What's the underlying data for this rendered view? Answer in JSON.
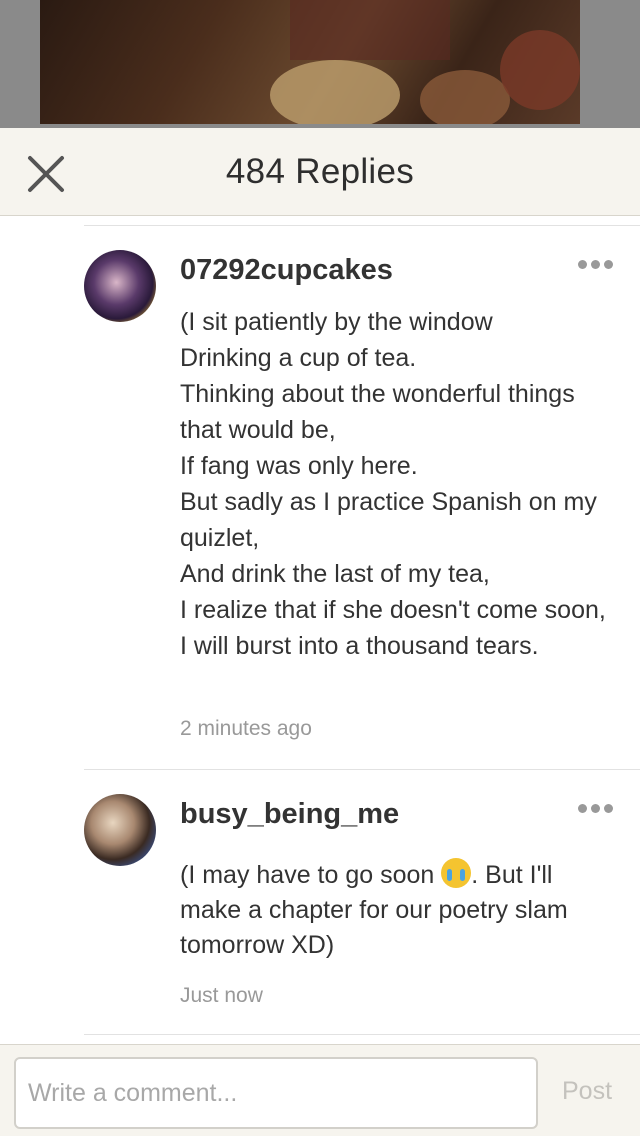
{
  "header": {
    "title": "484 Replies",
    "close_icon": "close-icon"
  },
  "replies": [
    {
      "username": "07292cupcakes",
      "body": "(I sit patiently by the window\nDrinking a cup of tea.\nThinking about the wonderful things that would be,\nIf fang was only here.\nBut sadly as I practice Spanish on my quizlet,\nAnd drink the last of my tea,\nI realize that if she doesn't come soon,\nI will burst into a thousand tears.",
      "timestamp": "2 minutes ago"
    },
    {
      "username": "busy_being_me",
      "body_before_emoji": "(I may have to go soon ",
      "emoji": "crying-face-emoji",
      "body_after_emoji": ". But I'll make a chapter for our poetry slam tomorrow XD)",
      "timestamp": "Just now"
    }
  ],
  "comment_bar": {
    "placeholder": "Write a comment...",
    "post_label": "Post"
  },
  "colors": {
    "header_bg": "#f6f4ee",
    "text": "#333333",
    "muted": "#999999"
  }
}
